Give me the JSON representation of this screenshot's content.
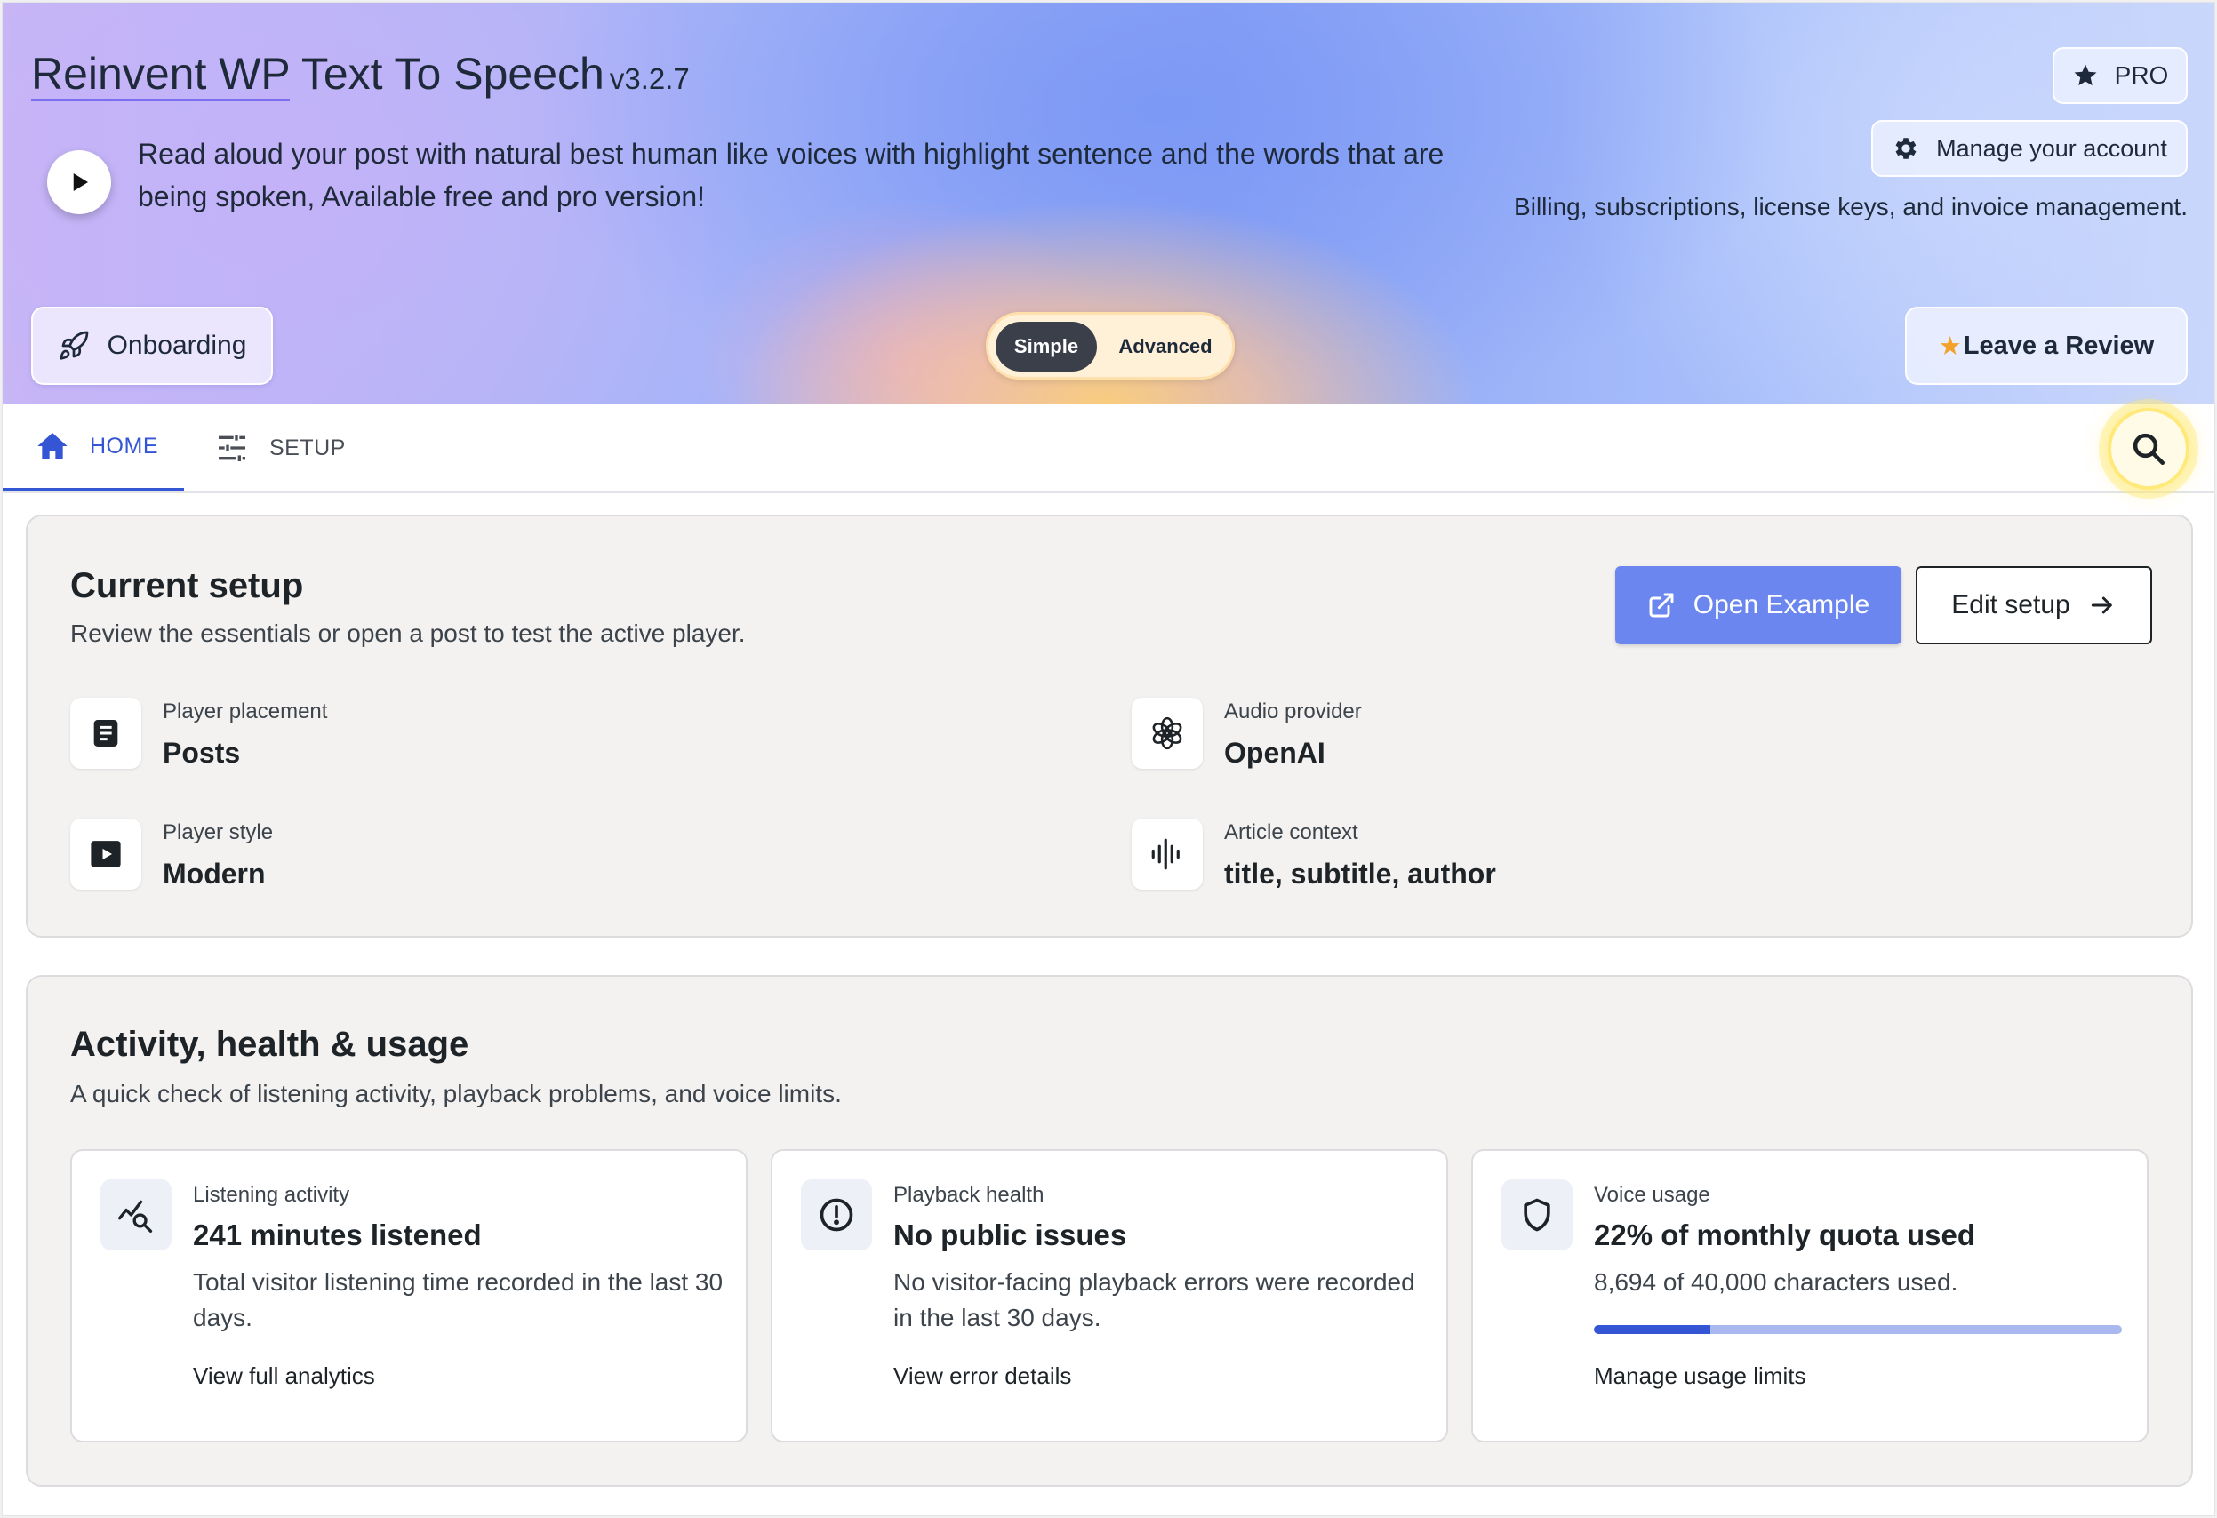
{
  "header": {
    "title_brand": "Reinvent WP",
    "title_rest": " Text To Speech",
    "version": "v3.2.7",
    "description": "Read aloud your post with natural best human like voices with highlight sentence and the words that are being spoken, Available free and pro version!",
    "pro_label": "PRO",
    "manage_account_label": "Manage your account",
    "billing_text": "Billing, subscriptions, license keys, and invoice management.",
    "onboarding_label": "Onboarding",
    "mode_simple": "Simple",
    "mode_advanced": "Advanced",
    "active_mode": "Simple",
    "review_star": "★",
    "review_label": "Leave a Review",
    "icons": {
      "play": "play-icon",
      "pro": "star-icon",
      "manage": "gear-icon",
      "onboarding": "rocket-icon",
      "review": "star-icon"
    }
  },
  "tabs": [
    {
      "label": "HOME",
      "icon": "home-icon",
      "active": true
    },
    {
      "label": "SETUP",
      "icon": "sliders-icon",
      "active": false
    }
  ],
  "search": {
    "icon": "search-icon"
  },
  "current_setup": {
    "title": "Current setup",
    "subtitle": "Review the essentials or open a post to test the active player.",
    "open_example_label": "Open Example",
    "edit_setup_label": "Edit setup",
    "items": [
      {
        "label": "Player placement",
        "value": "Posts",
        "icon": "document-icon"
      },
      {
        "label": "Audio provider",
        "value": "OpenAI",
        "icon": "openai-icon"
      },
      {
        "label": "Player style",
        "value": "Modern",
        "icon": "video-play-icon"
      },
      {
        "label": "Article context",
        "value": "title, subtitle, author",
        "icon": "waveform-icon"
      }
    ]
  },
  "activity": {
    "title": "Activity, health & usage",
    "subtitle": "A quick check of listening activity, playback problems, and voice limits.",
    "tiles": [
      {
        "label": "Listening activity",
        "value": "241 minutes listened",
        "description": "Total visitor listening time recorded in the last 30 days.",
        "link": "View full analytics",
        "icon": "analytics-search-icon"
      },
      {
        "label": "Playback health",
        "value": "No public issues",
        "description": "No visitor-facing playback errors were recorded in the last 30 days.",
        "link": "View error details",
        "icon": "alert-circle-icon"
      },
      {
        "label": "Voice usage",
        "value": "22% of monthly quota used",
        "description": "8,694 of 40,000 characters used.",
        "link": "Manage usage limits",
        "icon": "shield-icon",
        "usage_percent": 22
      }
    ]
  },
  "colors": {
    "accent": "#3455d4",
    "primary_button": "#6b86ee",
    "progress_track": "#a9b8ef",
    "review_star": "#f4a12b",
    "search_highlight": "#ffe97a"
  }
}
